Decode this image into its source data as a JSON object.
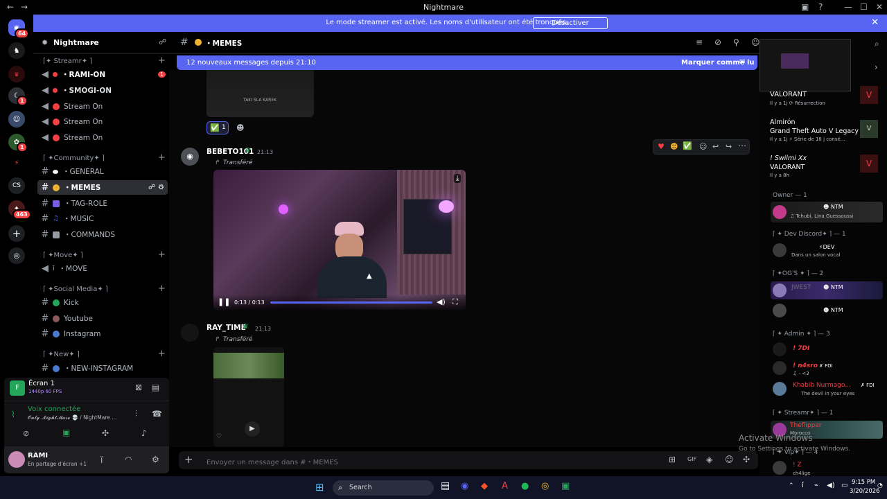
{
  "window": {
    "title": "Nightmare"
  },
  "banner": {
    "text": "Le mode streamer est activé. Les noms d'utilisateur ont été tronqués.",
    "button": "Désactiver"
  },
  "guilds": {
    "badge_top": "64",
    "badge_mid": "1",
    "badge_mid2": "1",
    "badge_bottom": "463",
    "cs": "CS"
  },
  "server": {
    "name": "Nightmare"
  },
  "sidebar": {
    "categories": [
      "⌈✦ Streamr✦ ⌉",
      "⌈ ✦Community✦ ⌉",
      "⌈ ✦Move✦ ⌉",
      "⌈ ✦Social Media✦ ⌉",
      "⌈ ✦New✦ ⌉"
    ],
    "channels": [
      {
        "label": "・RAMI-ON",
        "badge": "1"
      },
      {
        "label": "・SMOGI-ON"
      },
      {
        "label": "Stream On"
      },
      {
        "label": "Stream On"
      },
      {
        "label": "Stream On"
      },
      {
        "label": "・GENERAL"
      },
      {
        "label": "・MEMES"
      },
      {
        "label": "・TAG-ROLE"
      },
      {
        "label": "・MUSIC"
      },
      {
        "label": "・COMMANDS"
      },
      {
        "label": "・MOVE"
      },
      {
        "label": "Kick"
      },
      {
        "label": "Youtube"
      },
      {
        "label": "Instagram"
      },
      {
        "label": "・NEW-INSTAGRAM"
      }
    ]
  },
  "channel_header": {
    "name": "・MEMES"
  },
  "new_messages": {
    "text": "12 nouveaux messages depuis 21:10",
    "mark_read": "Marquer comme lu"
  },
  "messages": [
    {
      "author": "BEBETO101",
      "time": "21:13",
      "forwarded": "Transféré",
      "video_time": "0:13 / 0:13",
      "reaction_count": "1"
    },
    {
      "author": "RAY_TIME",
      "time": "21:13",
      "forwarded": "Transféré"
    }
  ],
  "top_video_caption": "TAKI SLA KAREK",
  "composer": {
    "placeholder": "Envoyer un message dans #・MEMES"
  },
  "activities": [
    {
      "game": "VALORANT",
      "meta": "Il y a 1j  ⟳ Résurrection"
    },
    {
      "name": "Almirón",
      "game": "Grand Theft Auto V Legacy",
      "meta": "Il y a 1j  ⚡ Série de 18 j consé..."
    },
    {
      "name": "! Swilmi Xx",
      "game": "VALORANT",
      "meta": "Il y a 8h"
    }
  ],
  "member_sections": [
    {
      "title": "Owner — 1"
    },
    {
      "title": "⌈ ✦ Dev Discord✦ ⌉ — 1"
    },
    {
      "title": "⌈ ✦OG'S ✦ ⌉ — 2"
    },
    {
      "title": "⌈ ✦ Admin ✦ ⌉ — 3"
    },
    {
      "title": "⌈ ✦ Streamr✦ ⌉ — 1"
    },
    {
      "title": "⌈ ✦ Vip✦ ⌉ — 4"
    }
  ],
  "members": {
    "owner": {
      "tag": "NTM",
      "status": "♫ Tchubi, Lina Guessoussi"
    },
    "dev": {
      "tag": "DEV",
      "status": "Dans un salon vocal"
    },
    "og1": {
      "name": "JWEST",
      "tag": "NTM"
    },
    "og2": {
      "tag": "NTM"
    },
    "admin1": {
      "name": "! 7DI"
    },
    "admin2": {
      "name": "! n4sro",
      "tag": "FDI",
      "status": "♫ - <3"
    },
    "admin3": {
      "name": "Khabib Nurmago...",
      "tag": "FDI",
      "status": "The devil in your eyes"
    },
    "streamer": {
      "name": "Theflipper",
      "status": "Morocco"
    },
    "vip": {
      "name": "! Z",
      "status": "ch4lige"
    }
  },
  "watermark": {
    "line1": "Activate Windows",
    "line2": "Go to Settings to activate Windows."
  },
  "stream": {
    "title": "Écran 1",
    "quality": "1440p 60 FPS"
  },
  "voice": {
    "status": "Voix connectée",
    "server": "𝓞𝓷𝓵𝔂 𝓝𝓲𝓰𝓱𝓽𝓜𝓪𝓻𝓮 💀 / NightMare ..."
  },
  "user": {
    "name": "RAMI",
    "status": "En partage d'écran +1"
  },
  "taskbar": {
    "search": "Search",
    "time": "9:15 PM",
    "date": "3/20/2026",
    "lang": "ENG"
  },
  "colors": {
    "blurple": "#5865f2",
    "bg": "#000000",
    "red": "#f23f43",
    "green": "#23a55a"
  }
}
